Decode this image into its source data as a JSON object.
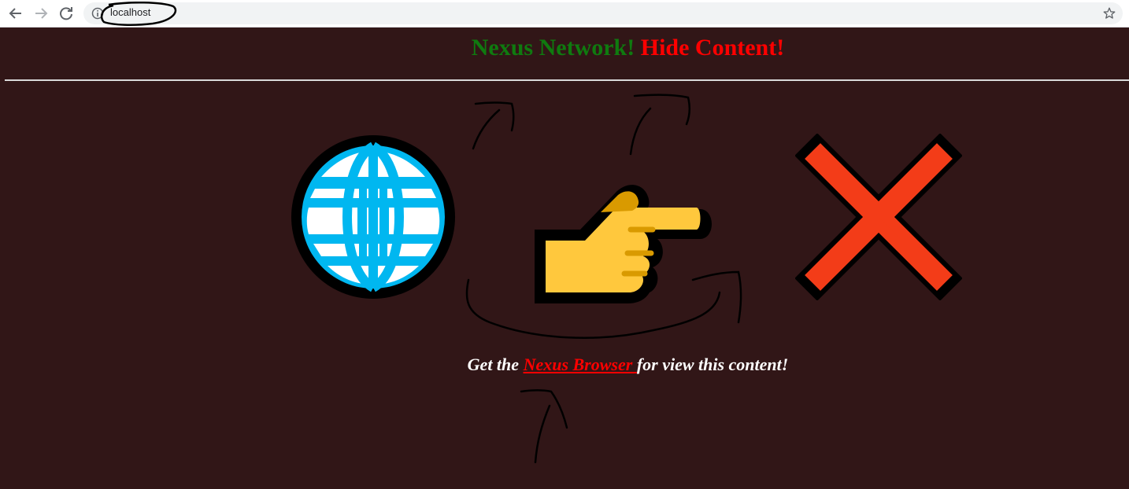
{
  "browser": {
    "url": "localhost",
    "back_icon": "arrow-left-icon",
    "forward_icon": "arrow-right-icon",
    "reload_icon": "reload-icon",
    "info_icon": "info-icon",
    "bookmark_icon": "star-icon"
  },
  "page": {
    "title_part1": "Nexus Network!",
    "title_part2": "Hide Content!",
    "tagline_before": "Get the ",
    "tagline_link": "Nexus Browser ",
    "tagline_after": " for view this content!",
    "icons": [
      "globe-icon",
      "pointing-hand-icon",
      "cross-mark-icon"
    ]
  },
  "colors": {
    "background": "#311617",
    "title_green": "#0f7a0f",
    "title_red": "#ff0000",
    "link_red": "#ff0000",
    "globe_blue": "#00b7f0",
    "hand_yellow": "#ffc83d",
    "cross_red": "#f33c18"
  }
}
